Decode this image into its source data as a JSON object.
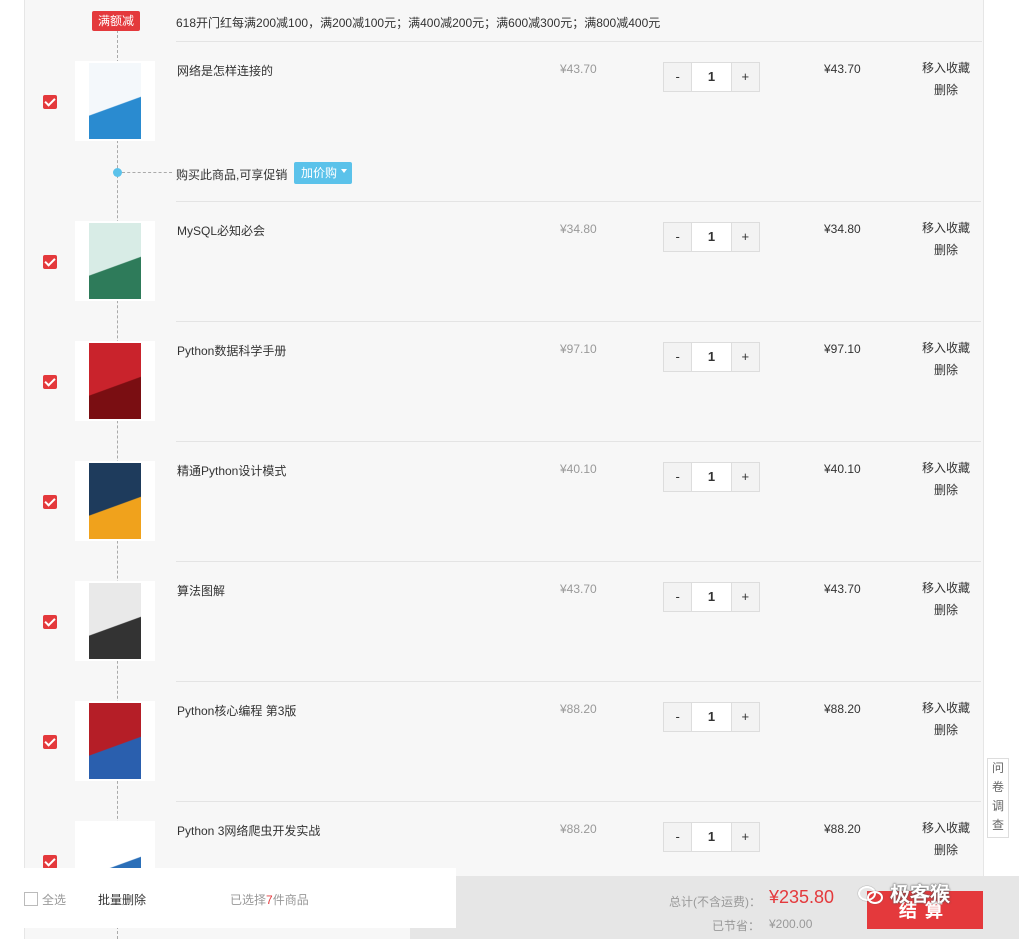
{
  "promotion": {
    "tag": "满额减",
    "text": "618开门红每满200减100，满200减100元；满400减200元；满600减300元；满800减400元"
  },
  "addon": {
    "text": "购买此商品,可享促销",
    "button": "加价购"
  },
  "items": [
    {
      "title": "网络是怎样连接的",
      "price": "¥43.70",
      "qty": "1",
      "subtotal": "¥43.70",
      "checked": true
    },
    {
      "title": "MySQL必知必会",
      "price": "¥34.80",
      "qty": "1",
      "subtotal": "¥34.80",
      "checked": true
    },
    {
      "title": "Python数据科学手册",
      "price": "¥97.10",
      "qty": "1",
      "subtotal": "¥97.10",
      "checked": true
    },
    {
      "title": "精通Python设计模式",
      "price": "¥40.10",
      "qty": "1",
      "subtotal": "¥40.10",
      "checked": true
    },
    {
      "title": "算法图解",
      "price": "¥43.70",
      "qty": "1",
      "subtotal": "¥43.70",
      "checked": true
    },
    {
      "title": "Python核心编程 第3版",
      "price": "¥88.20",
      "qty": "1",
      "subtotal": "¥88.20",
      "checked": true
    },
    {
      "title": "Python 3网络爬虫开发实战",
      "price": "¥88.20",
      "qty": "1",
      "subtotal": "¥88.20",
      "checked": true
    }
  ],
  "labels": {
    "minus": "-",
    "plus": "+",
    "move_to_favorites": "移入收藏",
    "delete": "删除"
  },
  "survey": [
    "问",
    "卷",
    "调",
    "查"
  ],
  "footer": {
    "select_all": "全选",
    "bulk_delete": "批量删除",
    "selected_prefix": "已选择",
    "selected_count": "7",
    "selected_suffix": "件商品",
    "total_label": "总计(不含运费)：",
    "total_amount": "¥235.80",
    "saved_label": "已节省：",
    "saved_amount": "¥200.00",
    "checkout": "结算"
  },
  "watermark": "极客猴",
  "colors": {
    "accent": "#e4393c",
    "addon": "#5bc2ea"
  }
}
